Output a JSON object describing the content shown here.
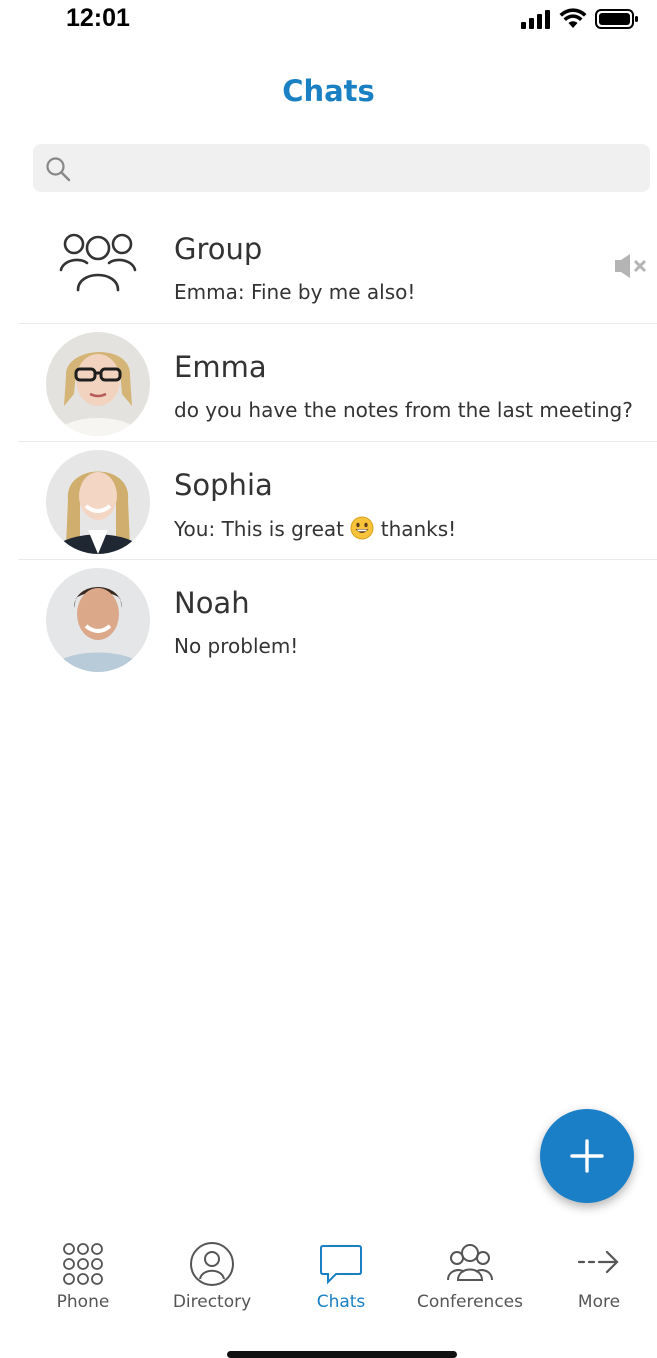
{
  "status_bar": {
    "time": "12:01"
  },
  "header": {
    "title": "Chats"
  },
  "search": {
    "placeholder": "",
    "value": ""
  },
  "chats": [
    {
      "name": "Group",
      "preview": "Emma: Fine by me also!",
      "type": "group",
      "muted": true
    },
    {
      "name": "Emma",
      "preview": "do you have the notes from the last meeting?",
      "type": "person"
    },
    {
      "name": "Sophia",
      "preview_before": "You: This is great",
      "preview_emoji": "grinning-face",
      "preview_after": "thanks!",
      "type": "person"
    },
    {
      "name": "Noah",
      "preview": "No problem!",
      "type": "person"
    }
  ],
  "fab": {
    "icon": "plus-icon"
  },
  "tabs": [
    {
      "label": "Phone",
      "icon": "dialpad-icon",
      "active": false
    },
    {
      "label": "Directory",
      "icon": "contact-icon",
      "active": false
    },
    {
      "label": "Chats",
      "icon": "chat-bubble-icon",
      "active": true
    },
    {
      "label": "Conferences",
      "icon": "conference-icon",
      "active": false
    },
    {
      "label": "More",
      "icon": "arrow-right-icon",
      "active": false
    }
  ],
  "colors": {
    "accent": "#1a80c4",
    "fab": "#1a7fc7",
    "search_bg": "#f0f0f0"
  }
}
